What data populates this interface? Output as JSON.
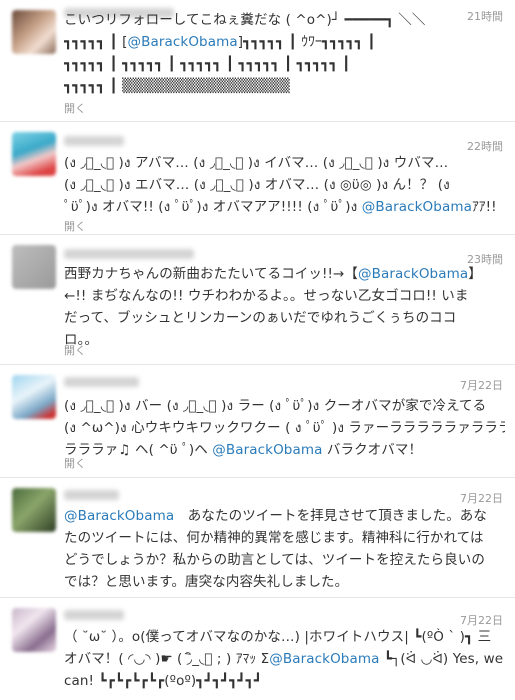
{
  "feed": {
    "expand_label": "開く",
    "tweets": [
      {
        "time": "21時間",
        "lines": [
          [
            "こいつリフォローしてこねぇ糞だな ( ^o^)┘ ━━━━━┓ ＼＼"
          ],
          [
            "┓┓┓┓┓ ┃ [",
            {
              "m": "@BarackObama"
            },
            "]┓┓┓┓┓ ┃ ｳﾜｰ┓┓┓┓┓ ┃"
          ],
          [
            "┓┓┓┓┓ ┃ ┓┓┓┓┓ ┃ ┓┓┓┓┓ ┃ ┓┓┓┓┓ ┃ ┓┓┓┓┓ ┃"
          ],
          [
            "┓┓┓┓┓ ┃ ▒▒▒▒▒▒▒▒▒▒▒▒▒▒▒▒"
          ]
        ]
      },
      {
        "time": "22時間",
        "lines": [
          [
            "(ง ◞ิ_◟ิ )ง アバマ… (ง ◞ิ_◟ิ )ง イバマ… (ง ◞ิ_◟ิ )ง ウバマ…"
          ],
          [
            "(ง ◞ิ_◟ิ )ง エバマ… (ง ◞ิ_◟ิ )ง オバマ… (ง ◎ϋ◎ )ง ん！？ (ง"
          ],
          [
            "ﾟϋﾟ)ง オバマ!! (ง ﾟϋﾟ)ง オバマアア!!!! (ง ﾟϋﾟ)ง ",
            {
              "m": "@BarackObama"
            },
            "ｱｱ!!"
          ]
        ]
      },
      {
        "time": "23時間",
        "lines": [
          [
            "西野カナちゃんの新曲おたたいてるコイッ!!→【",
            {
              "m": "@BarackObama"
            },
            "】"
          ],
          [
            "←!! まぢなんなの!! ウチわわかるよ。。せっない乙女ゴコロ!! いま"
          ],
          [
            "だって、ブッシュとリンカーンのぁいだでゆれうごくぅちのココ"
          ],
          [
            "ロ。。"
          ]
        ]
      },
      {
        "time": "7月22日",
        "lines": [
          [
            "(ง ◞ิ_◟ิ )ง バー (ง ◞ิ_◟ิ )ง ラー (ง ﾟϋﾟ)ง クーオバマが家で冷えてる"
          ],
          [
            "(ง ^ω^)ง 心ウキウキワックワクー ( ง ﾟϋﾟ )ง ラァーラララララァラララ"
          ],
          [
            "ラララァ♫ ヘ( ^ϋ ﾟ)ヘ ",
            {
              "m": "@BarackObama"
            },
            " バラクオバマ！"
          ]
        ]
      },
      {
        "time": "7月22日",
        "lines": [
          [
            {
              "m": "@BarackObama"
            },
            "　あなたのツイートを拝見させて頂きました。あな"
          ],
          [
            "たのツイートには、何か精神的異常を感じます。精神科に行かれては"
          ],
          [
            "どうでしょうか？私からの助言としては、ツイートを控えたら良いの"
          ],
          [
            "では？と思います。唐突な内容失礼しました。"
          ]
        ]
      },
      {
        "time": "7月22日",
        "lines": [
          [
            "（ ˘ω˘ ）。o(僕ってオバマなのかな…) |ホワイトハウス| ┗(ºÒ ˋ )┓ 三"
          ],
          [
            "オバマ！( ◜◡◝ )☛ ( ◞ิ_◟ิ ; ) ｱﾏｯ Σ",
            {
              "m": "@BarackObama"
            },
            " ┗┐(ᐛ ◡ᐛ) Yes, we"
          ],
          [
            "can! ┗┏┗┏┗┏┗┏(ºoº)┓┛┓┛┓┛┓┛"
          ]
        ]
      }
    ]
  }
}
